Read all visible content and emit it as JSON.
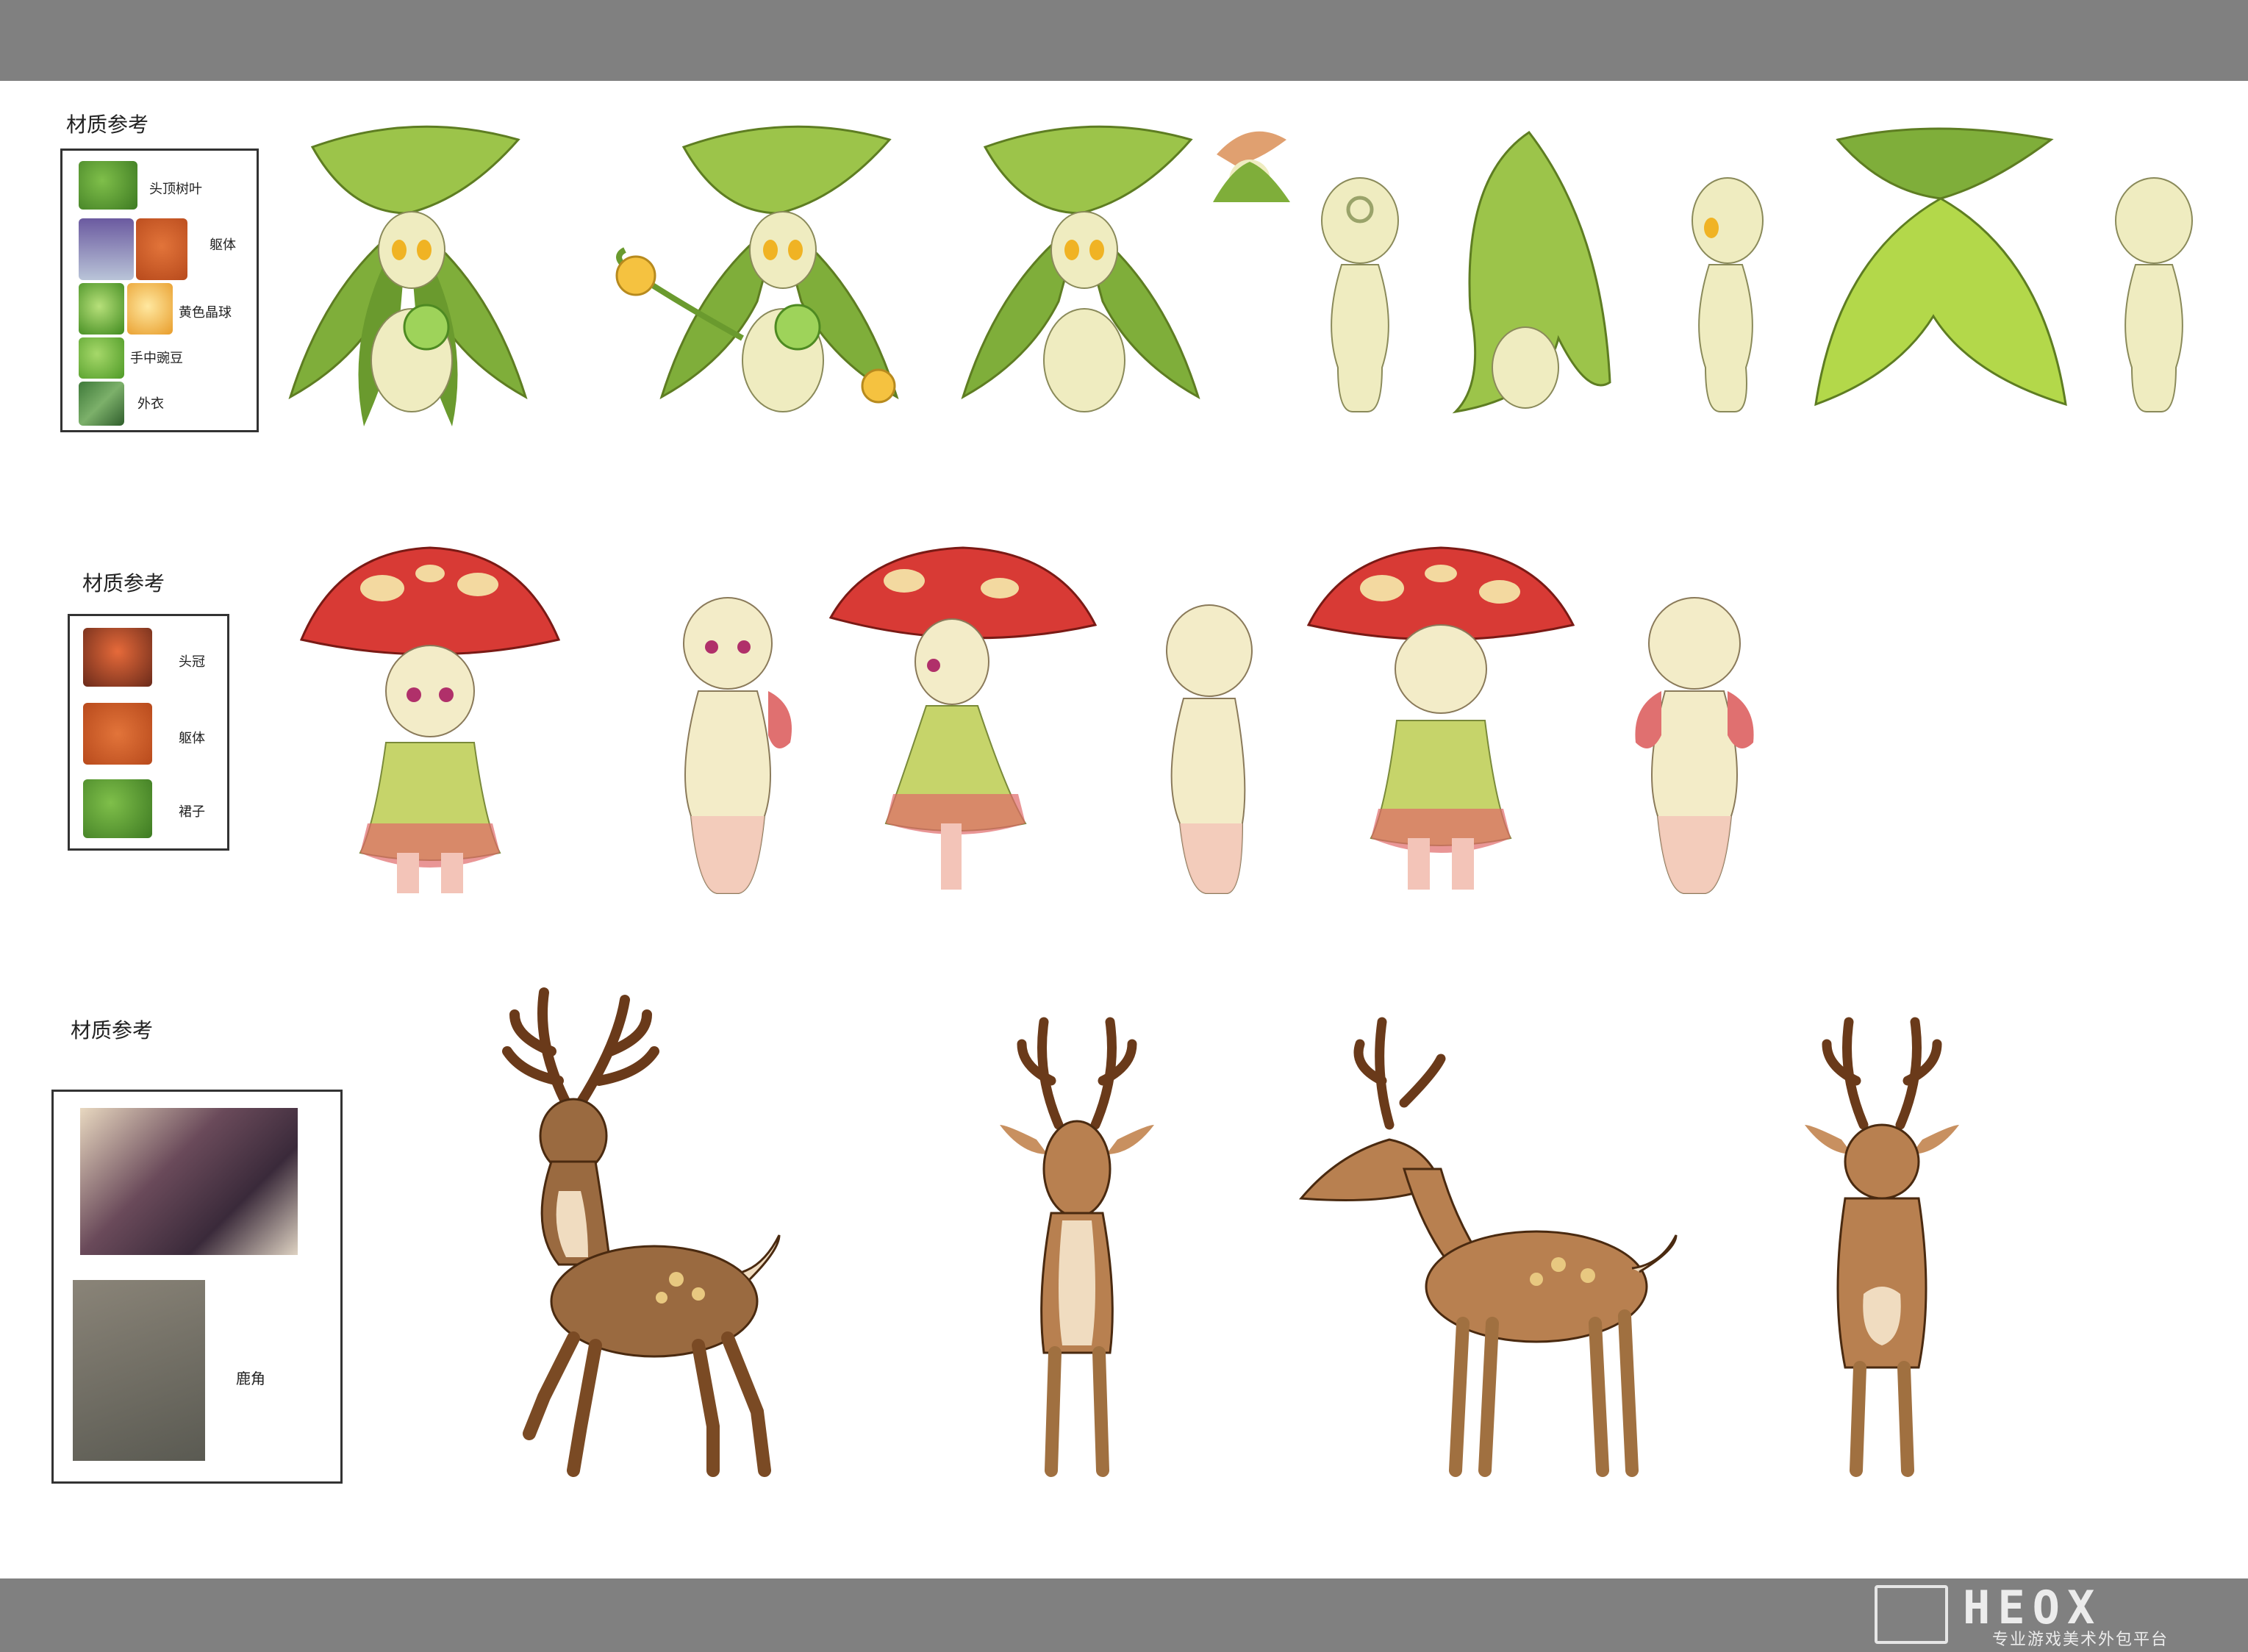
{
  "sections": [
    {
      "title": "材质参考",
      "refs": [
        "头顶树叶",
        "躯体",
        "黄色晶球",
        "手中豌豆",
        "外衣"
      ]
    },
    {
      "title": "材质参考",
      "refs": [
        "头冠",
        "躯体",
        "裙子"
      ]
    },
    {
      "title": "材质参考",
      "refs": [
        "鹿角"
      ]
    }
  ],
  "watermark": {
    "logo": "HEOX",
    "tagline": "专业游戏美术外包平台"
  },
  "colors": {
    "band": "#808080",
    "leaf_green": "#8fb33a",
    "body_cream": "#efecc0",
    "mushroom_red": "#d83a35",
    "deer_brown": "#9a6a40"
  }
}
